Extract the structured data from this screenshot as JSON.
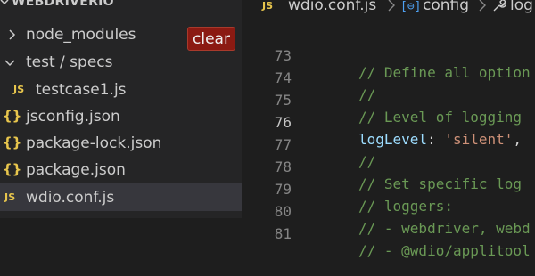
{
  "explorer": {
    "title": "WEBDRIVERIO",
    "items": [
      {
        "label": "node_modules",
        "type": "folder",
        "expanded": false
      },
      {
        "label": "test / specs",
        "type": "folder",
        "expanded": true
      },
      {
        "label": "testcase1.js",
        "type": "js",
        "icon_text": "JS"
      },
      {
        "label": "jsconfig.json",
        "type": "json",
        "icon_text": "{}"
      },
      {
        "label": "package-lock.json",
        "type": "json",
        "icon_text": "{}"
      },
      {
        "label": "package.json",
        "type": "json",
        "icon_text": "{}"
      },
      {
        "label": "wdio.conf.js",
        "type": "js",
        "icon_text": "JS",
        "selected": true
      }
    ]
  },
  "terminal": {
    "clear_label": "clear"
  },
  "breadcrumb": {
    "file_icon": "JS",
    "file": "wdio.conf.js",
    "symbol": "config",
    "symbol2": "log"
  },
  "editor": {
    "lines": [
      {
        "number": "73",
        "code": "// Define all option"
      },
      {
        "number": "74",
        "code": "//"
      },
      {
        "number": "75",
        "code": "// Level of logging"
      },
      {
        "number": "76",
        "key": "logLevel",
        "colon": ": ",
        "value": "'silent'",
        "trail": ","
      },
      {
        "number": "77",
        "code": "//"
      },
      {
        "number": "78",
        "code": "// Set specific log"
      },
      {
        "number": "79",
        "code": "// loggers:"
      },
      {
        "number": "80",
        "code": "// - webdriver, webd"
      },
      {
        "number": "81",
        "code": "// - @wdio/applitool"
      }
    ]
  },
  "colors": {
    "sidebar_bg": "#252526",
    "editor_bg": "#1e1e1e",
    "selected_row_bg": "#37373d",
    "comment": "#6a9955",
    "property": "#9cdcfe",
    "string": "#ce9178",
    "js_badge": "#e8c64d",
    "clear_button": "#8b1a12"
  }
}
